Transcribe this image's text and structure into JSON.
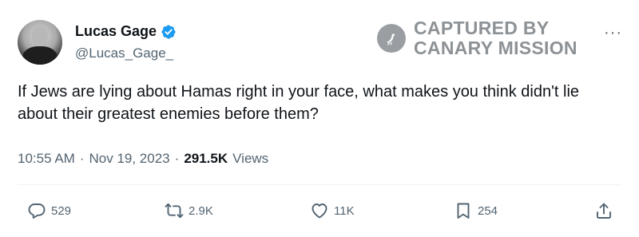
{
  "author": {
    "display_name": "Lucas Gage",
    "handle": "@Lucas_Gage_"
  },
  "watermark": {
    "line1": "CAPTURED BY",
    "line2": "CANARY MISSION"
  },
  "more_label": "···",
  "tweet": {
    "text": "If Jews are lying about Hamas right in your face, what makes you think didn't lie about their greatest enemies before them?",
    "time": "10:55 AM",
    "date": "Nov 19, 2023",
    "views_count": "291.5K",
    "views_label": "Views",
    "separator": "·"
  },
  "actions": {
    "replies": "529",
    "reposts": "2.9K",
    "likes": "11K",
    "bookmarks": "254"
  },
  "colors": {
    "verified_badge": "#1d9bf0",
    "text_primary": "#0f1419",
    "text_secondary": "#536471",
    "watermark": "#8d9296"
  },
  "icons": {
    "verified": "verified-badge-icon",
    "watermark": "canary-bird-icon",
    "more": "more-horizontal-icon",
    "reply": "reply-bubble-icon",
    "repost": "repost-arrows-icon",
    "like": "heart-icon",
    "bookmark": "bookmark-icon",
    "share": "share-upload-icon"
  }
}
